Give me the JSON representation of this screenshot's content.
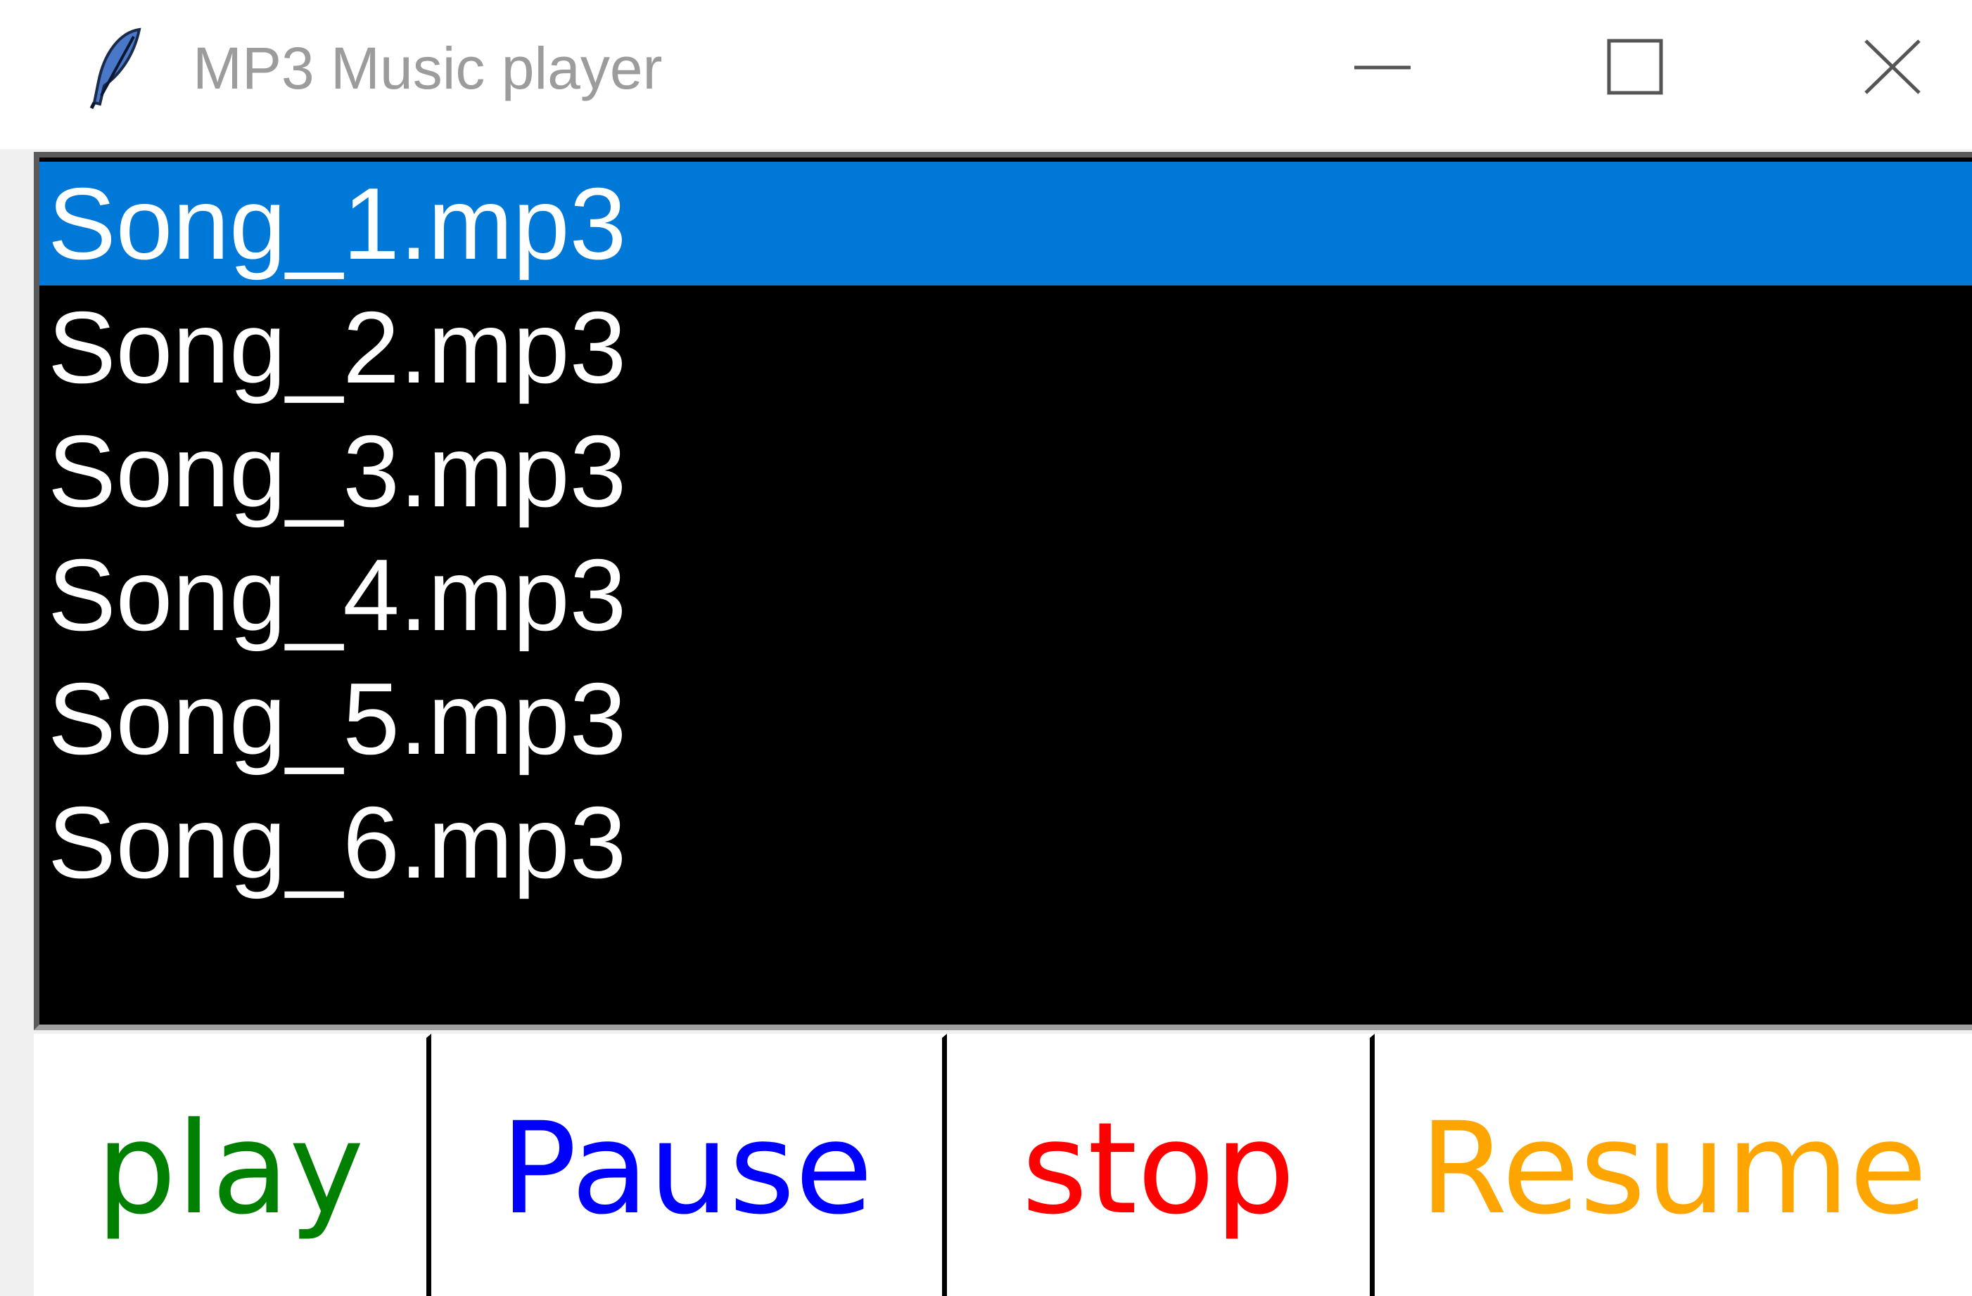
{
  "window": {
    "title": "MP3 Music player",
    "icons": {
      "app": "feather-icon",
      "minimize": "minimize-icon",
      "maximize": "maximize-icon",
      "close": "close-icon"
    }
  },
  "playlist": {
    "songs": [
      "Song_1.mp3",
      "Song_2.mp3",
      "Song_3.mp3",
      "Song_4.mp3",
      "Song_5.mp3",
      "Song_6.mp3"
    ],
    "selected_index": 0,
    "colors": {
      "background": "#000000",
      "text": "#ffffff",
      "selection": "#0078d7"
    }
  },
  "controls": {
    "play": {
      "label": "play",
      "color": "#008000"
    },
    "pause": {
      "label": "Pause",
      "color": "#0000ff"
    },
    "stop": {
      "label": "stop",
      "color": "#ff0000"
    },
    "resume": {
      "label": "Resume",
      "color": "#ffa500"
    }
  }
}
